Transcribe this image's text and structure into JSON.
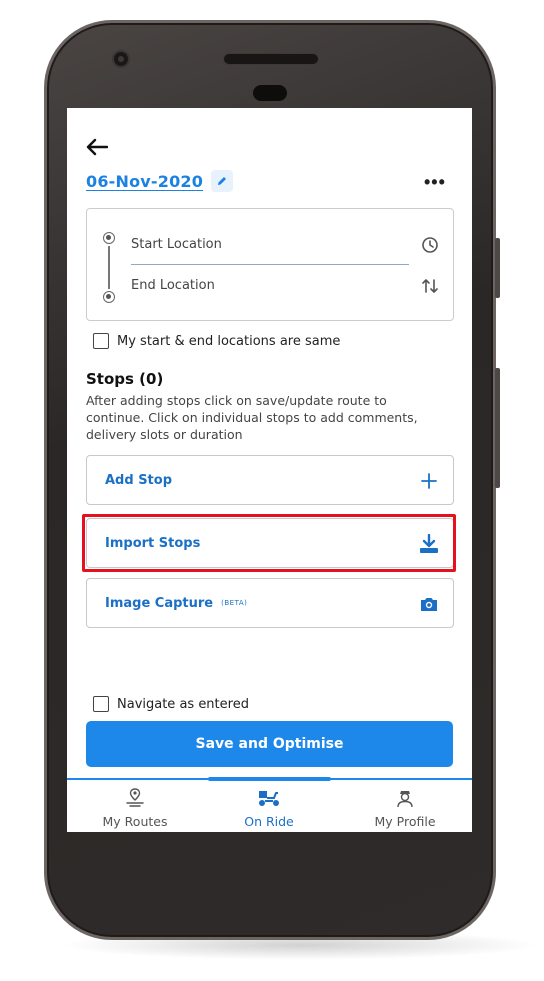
{
  "header": {
    "date": "06-Nov-2020",
    "back_icon": "arrow-left-icon",
    "edit_icon": "pencil-icon",
    "more_icon": "more-horizontal-icon",
    "more_label": "•••"
  },
  "locations": {
    "start_placeholder": "Start Location",
    "end_placeholder": "End Location",
    "start_icon": "clock-icon",
    "end_icon": "swap-vertical-icon"
  },
  "options": {
    "same_locations_label": "My start & end locations are same",
    "same_locations_checked": false,
    "navigate_label": "Navigate as entered",
    "navigate_checked": false
  },
  "stops": {
    "title": "Stops (0)",
    "description": "After adding stops click on save/update route to continue. Click on individual stops to add comments, delivery slots or duration"
  },
  "actions": {
    "add_stop": "Add Stop",
    "import_stops": "Import Stops",
    "image_capture": "Image Capture",
    "beta_tag": "(BETA)",
    "add_icon": "plus-icon",
    "import_icon": "download-icon",
    "capture_icon": "camera-icon"
  },
  "save_button": "Save and Optimise",
  "nav": {
    "items": [
      {
        "label": "My Routes",
        "icon": "route-pin-icon",
        "active": false
      },
      {
        "label": "On Ride",
        "icon": "delivery-scooter-icon",
        "active": true
      },
      {
        "label": "My Profile",
        "icon": "profile-icon",
        "active": false
      }
    ]
  },
  "colors": {
    "accent": "#1e88ea",
    "link": "#1b70c6",
    "highlight": "#e3121c"
  }
}
